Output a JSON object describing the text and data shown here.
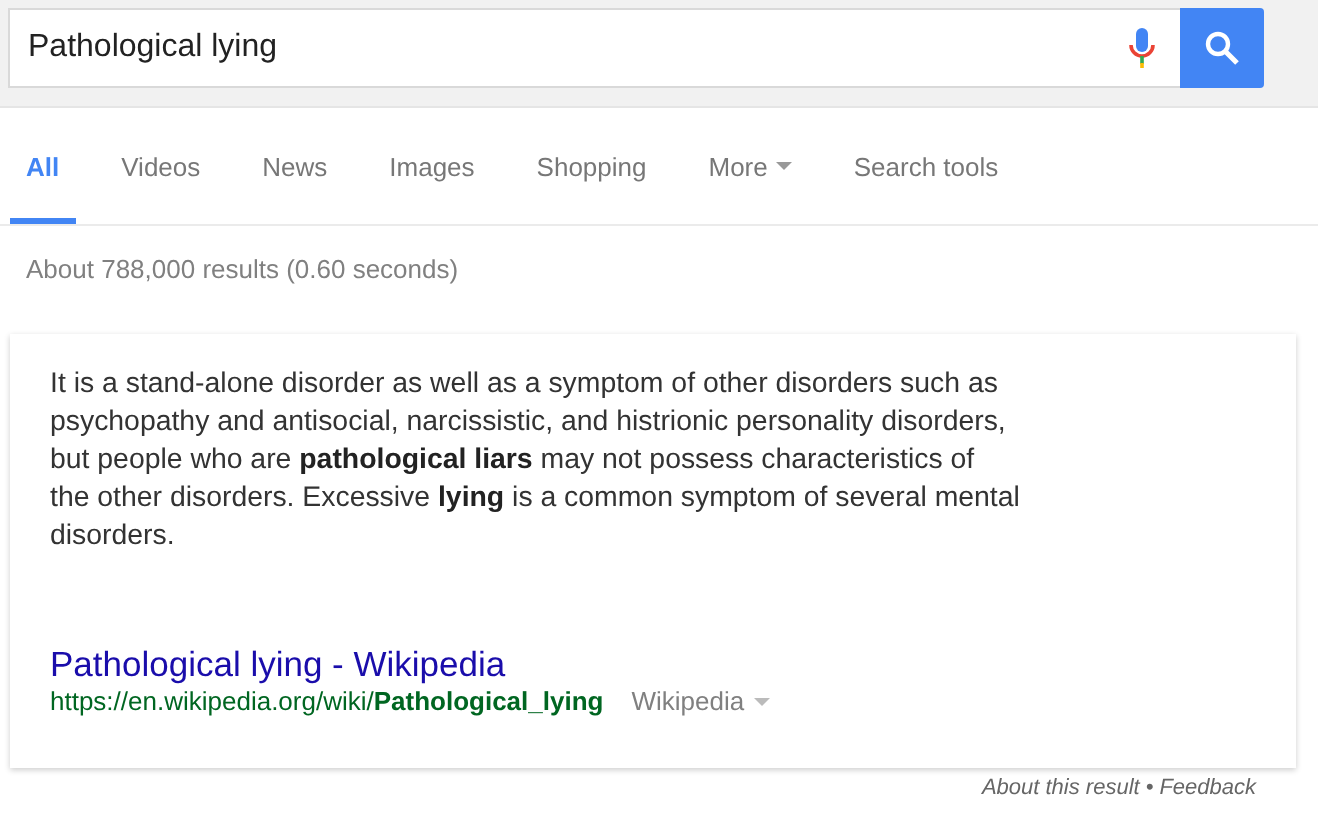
{
  "search": {
    "value": "Pathological lying"
  },
  "tabs": [
    {
      "label": "All",
      "selected": true
    },
    {
      "label": "Videos",
      "selected": false
    },
    {
      "label": "News",
      "selected": false
    },
    {
      "label": "Images",
      "selected": false
    },
    {
      "label": "Shopping",
      "selected": false
    },
    {
      "label": "More",
      "selected": false,
      "kind": "menu"
    },
    {
      "label": "Search tools",
      "selected": false
    }
  ],
  "result_stats": "About 788,000 results (0.60 seconds)",
  "card": {
    "snippet": "It is a stand-alone disorder as well as a symptom of other disorders such as psychopathy and antisocial, narcissistic, and histrionic personality disorders, but people who are **pathological liars** may not possess characteristics of the other disorders. Excessive **lying** is a common symptom of several mental disorders.",
    "link_title": "Pathological lying - Wikipedia",
    "url": "https://en.wikipedia.org/wiki/**Pathological_lying**",
    "source": "Wikipedia"
  },
  "footer": {
    "about": "About this result",
    "separator": "•",
    "feedback": "Feedback"
  }
}
